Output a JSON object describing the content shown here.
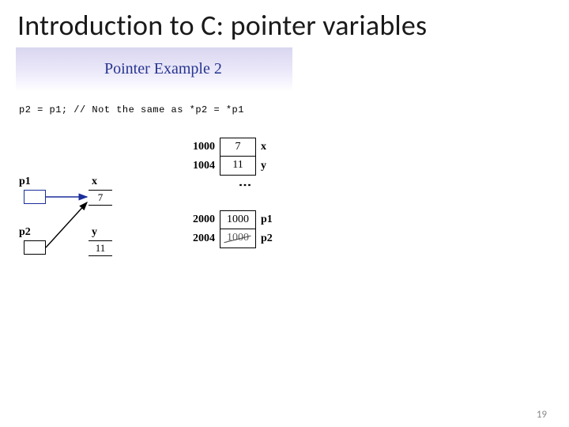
{
  "slide": {
    "title": "Introduction to C: pointer variables",
    "page_number": "19"
  },
  "example": {
    "header": "Pointer Example 2",
    "code": "p2 = p1;  // Not the same as *p2 = *p1"
  },
  "left_diagram": {
    "p1": "p1",
    "p2": "p2",
    "x": "x",
    "y": "y",
    "x_val": "7",
    "y_val": "11"
  },
  "memory": {
    "top": [
      {
        "addr": "1000",
        "value": "7",
        "name": "x"
      },
      {
        "addr": "1004",
        "value": "11",
        "name": "y"
      }
    ],
    "bottom": [
      {
        "addr": "2000",
        "value": "1000",
        "name": "p1"
      },
      {
        "addr": "2004",
        "value": "1000",
        "name": "p2",
        "strike": true
      }
    ]
  }
}
